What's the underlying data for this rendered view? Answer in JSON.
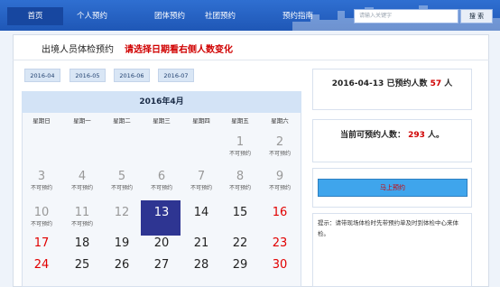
{
  "nav": {
    "items": [
      {
        "label": "首页",
        "active": true
      },
      {
        "label": "个人预约",
        "active": false
      },
      {
        "label": "团体预约",
        "active": false
      },
      {
        "label": "社团预约",
        "active": false
      },
      {
        "label": "预约指南",
        "active": false
      }
    ],
    "search_placeholder": "请输入关键字",
    "search_button": "搜 索"
  },
  "header": {
    "title": "出境人员体检预约",
    "subtitle": "请选择日期看右侧人数变化"
  },
  "months": [
    "2016-04",
    "2016-05",
    "2016-06",
    "2016-07"
  ],
  "calendar": {
    "title": "2016年4月",
    "weekdays": [
      "星期日",
      "星期一",
      "星期二",
      "星期三",
      "星期四",
      "星期五",
      "星期六"
    ],
    "unavailable_label": "不可预约",
    "days": [
      {
        "n": "1",
        "status": "unavailable"
      },
      {
        "n": "2",
        "status": "unavailable"
      },
      {
        "n": "3",
        "status": "unavailable"
      },
      {
        "n": "4",
        "status": "unavailable"
      },
      {
        "n": "5",
        "status": "unavailable"
      },
      {
        "n": "6",
        "status": "unavailable"
      },
      {
        "n": "7",
        "status": "unavailable"
      },
      {
        "n": "8",
        "status": "unavailable"
      },
      {
        "n": "9",
        "status": "unavailable"
      },
      {
        "n": "10",
        "status": "unavailable"
      },
      {
        "n": "11",
        "status": "unavailable"
      },
      {
        "n": "12",
        "status": "past"
      },
      {
        "n": "13",
        "status": "selected"
      },
      {
        "n": "14",
        "status": "open"
      },
      {
        "n": "15",
        "status": "open"
      },
      {
        "n": "16",
        "status": "weekend"
      },
      {
        "n": "17",
        "status": "weekend"
      },
      {
        "n": "18",
        "status": "open"
      },
      {
        "n": "19",
        "status": "open"
      },
      {
        "n": "20",
        "status": "open"
      },
      {
        "n": "21",
        "status": "open"
      },
      {
        "n": "22",
        "status": "open"
      },
      {
        "n": "23",
        "status": "weekend"
      },
      {
        "n": "24",
        "status": "weekend"
      },
      {
        "n": "25",
        "status": "open"
      },
      {
        "n": "26",
        "status": "open"
      },
      {
        "n": "27",
        "status": "open"
      },
      {
        "n": "28",
        "status": "open"
      },
      {
        "n": "29",
        "status": "open"
      },
      {
        "n": "30",
        "status": "weekend"
      }
    ]
  },
  "info": {
    "booked_date": "2016-04-13",
    "booked_label": "已预约人数",
    "booked_count": "57",
    "unit": "人",
    "available_label": "当前可预约人数：",
    "available_count": "293",
    "available_unit": "人。",
    "book_button": "马上预约",
    "tip": "提示：请带现场体检时先带预约单及时到体检中心来体检。"
  },
  "colors": {
    "nav": "#2b65c9",
    "accent_red": "#d00000",
    "selected": "#2e3592",
    "button": "#3fa5ec"
  }
}
